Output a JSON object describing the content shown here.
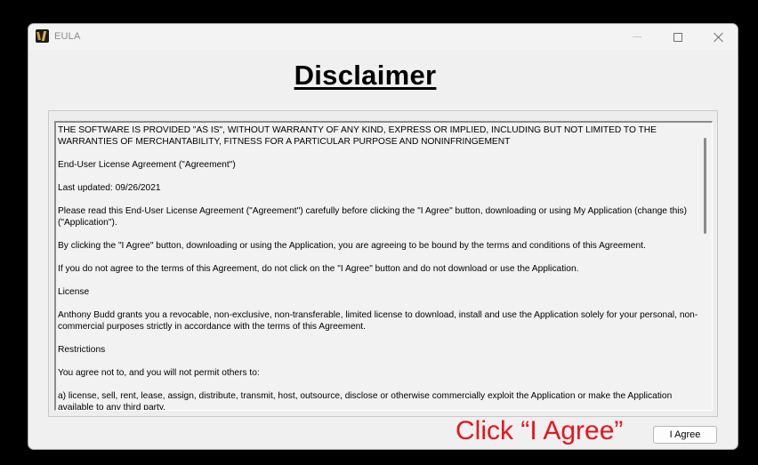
{
  "window": {
    "title": "EULA",
    "icon": "app-logo-icon",
    "controls": [
      "minimize-icon",
      "maximize-icon",
      "close-icon"
    ]
  },
  "heading": "Disclaimer",
  "eula": {
    "paragraphs": [
      "THE SOFTWARE IS PROVIDED \"AS IS\", WITHOUT WARRANTY OF ANY KIND, EXPRESS OR IMPLIED, INCLUDING BUT NOT LIMITED TO THE WARRANTIES OF MERCHANTABILITY, FITNESS FOR A PARTICULAR PURPOSE AND NONINFRINGEMENT",
      "End-User License Agreement (\"Agreement\")",
      "Last updated: 09/26/2021",
      "Please read this End-User License Agreement (\"Agreement\") carefully before clicking the \"I Agree\" button, downloading or using My Application (change this) (\"Application\").",
      "By clicking the \"I Agree\" button, downloading or using the Application, you are agreeing to be bound by the terms and conditions of this Agreement.",
      "If you do not agree to the terms of this Agreement, do not click on the \"I Agree\" button and do not download or use the Application.",
      "License",
      "Anthony Budd grants you a revocable, non-exclusive, non-transferable, limited license to download, install and use the Application solely for your personal, non-commercial purposes strictly in accordance with the terms of this Agreement.",
      "Restrictions",
      "You agree not to, and you will not permit others to:",
      "a) license, sell, rent, lease, assign, distribute, transmit, host, outsource, disclose or otherwise commercially exploit the Application or make the Application available to any third party."
    ]
  },
  "annotation": "Click “I Agree”",
  "buttons": {
    "agree_label": "I Agree"
  },
  "colors": {
    "annotation": "#e8141c",
    "window_bg": "#f0f0f0",
    "backdrop": "#000000"
  }
}
